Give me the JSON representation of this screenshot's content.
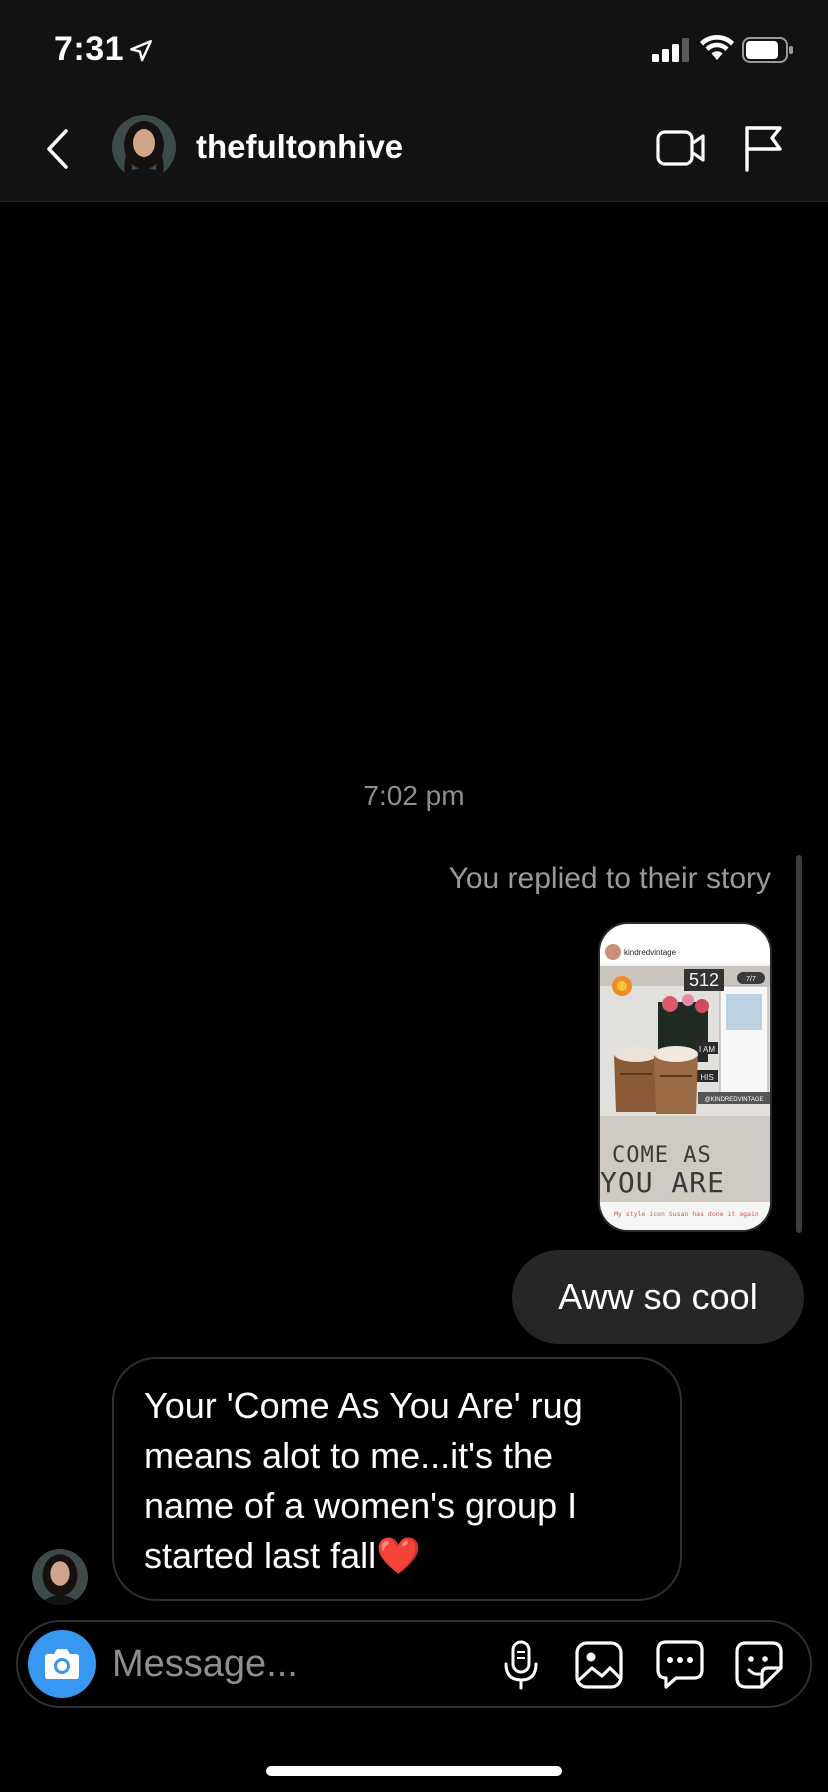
{
  "status_bar": {
    "time": "7:31"
  },
  "header": {
    "username": "thefultonhive"
  },
  "thread": {
    "timestamp": "7:02 pm",
    "story_reply_label": "You replied to their story",
    "story": {
      "account": "kindredvintage",
      "counter": "7/7",
      "house_number": "512",
      "sign_1": "I AM",
      "sign_2": "HIS",
      "tag": "@KINDREDVINTAGE",
      "rug_line_1": "COME  AS",
      "rug_line_2": "YOU  ARE",
      "caption": "My style icon Susan has done it again"
    },
    "outgoing_message": "Aww so cool",
    "incoming_message": "Your 'Come As You Are' rug means alot to me...it's the name of a women's group I started last fall❤️"
  },
  "composer": {
    "placeholder": "Message..."
  },
  "colors": {
    "background": "#000000",
    "header_bg": "#121212",
    "outgoing_bubble": "#262626",
    "camera_button": "#3897f0",
    "muted_text": "#8e8e8e"
  }
}
